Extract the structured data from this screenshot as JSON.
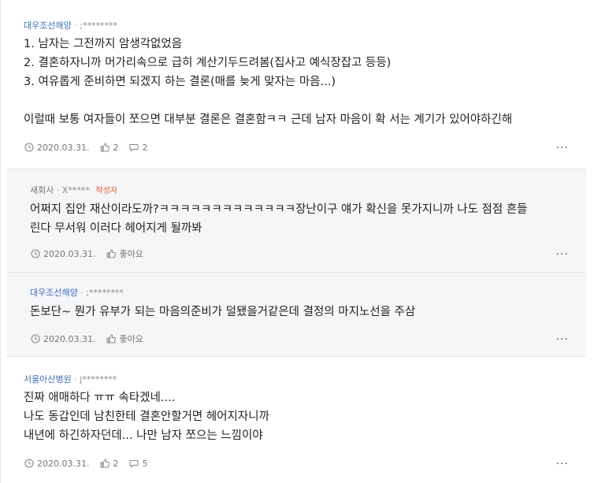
{
  "comments": [
    {
      "company": "대우조선해양",
      "uid": ";********",
      "lines": "1. 남자는 그전까지 암생각없었음\n2. 결혼하자니까 머가리속으로 급히 계산기두드려봄(집사고 예식장잡고 등등)\n3. 여유롭게 준비하면 되겠지 하는 결론(매를 늦게 맞자는 마음...)\n\n이럴때 보통 여자들이 쪼으면 대부분 결론은 결혼함ㅋㅋ 근데 남자 마음이 확 서는 계기가 있어야하긴해",
      "date": "2020.03.31.",
      "likes": "2",
      "replies": "2"
    },
    {
      "company": "새회사",
      "uid": "X*****",
      "op_label": "작성자",
      "lines": "어쩌지 집안 재산이라도까?ㅋㅋㅋㅋㅋㅋㅋㅋㅋㅋㅋㅋㅋ장난이구 얘가 확신을 못가지니까 나도 점점 흔들\n린다 무서워 이러다 헤어지게 될까봐",
      "date": "2020.03.31.",
      "like_label": "좋아요"
    },
    {
      "company": "대우조선해양",
      "uid": ";********",
      "lines": "돈보단~ 뭔가 유부가 되는 마음의준비가 덜됐을거같은데 결정의 마지노선을 주삼",
      "date": "2020.03.31.",
      "like_label": "좋아요"
    },
    {
      "company": "서울아산병원",
      "uid": "j********",
      "lines": "진짜 애매하다 ㅠㅠ 속타겠네....\n나도 동갑인데 남친한테 결혼안할거면 헤어지자니까\n내년에 하긴하자던데... 나만 남자 쪼으는 느낌이야",
      "date": "2020.03.31.",
      "likes": "2",
      "replies": "5"
    }
  ],
  "more_label": "...",
  "colors": {
    "company_blue": "#3b6fc4",
    "op_orange": "#e8542c",
    "reply_bg": "#f5f6f8"
  },
  "icons": [
    "clock-icon",
    "thumbs-up-icon",
    "speech-bubble-icon",
    "more-icon"
  ]
}
